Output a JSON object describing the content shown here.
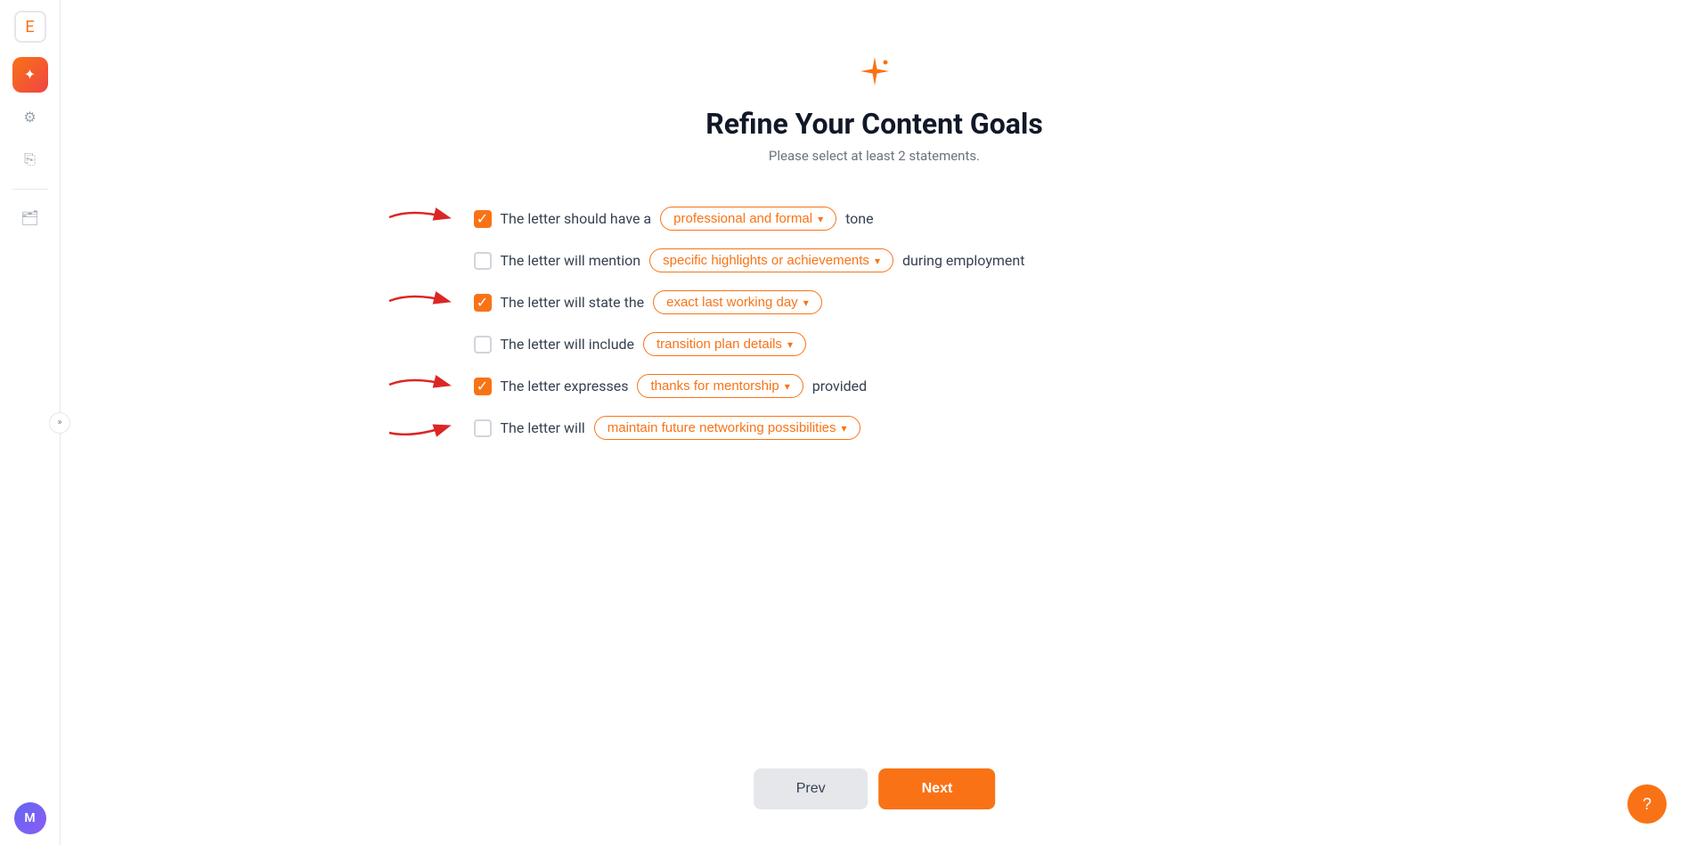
{
  "sidebar": {
    "logo_icon": "E",
    "items": [
      {
        "id": "sparkle",
        "icon": "✦",
        "active": true
      },
      {
        "id": "webhook",
        "icon": "⚙"
      },
      {
        "id": "copy",
        "icon": "⎘"
      }
    ],
    "collapse_icon": "»",
    "folder_icon": "📁",
    "avatar_label": "M"
  },
  "page": {
    "star_icon": "✦",
    "title": "Refine Your Content Goals",
    "subtitle": "Please select at least 2 statements."
  },
  "statements": [
    {
      "id": "tone",
      "checked": true,
      "prefix": "The letter should have a",
      "dropdown_value": "professional and formal",
      "suffix": "tone",
      "has_arrow": true
    },
    {
      "id": "highlights",
      "checked": false,
      "prefix": "The letter will mention",
      "dropdown_value": "specific highlights or achievements",
      "suffix": "during employment",
      "has_arrow": false
    },
    {
      "id": "lastday",
      "checked": true,
      "prefix": "The letter will state the",
      "dropdown_value": "exact last working day",
      "suffix": "",
      "has_arrow": true
    },
    {
      "id": "transition",
      "checked": false,
      "prefix": "The letter will include",
      "dropdown_value": "transition plan details",
      "suffix": "",
      "has_arrow": false
    },
    {
      "id": "mentorship",
      "checked": true,
      "prefix": "The letter expresses",
      "dropdown_value": "thanks for mentorship",
      "suffix": "provided",
      "has_arrow": true
    },
    {
      "id": "networking",
      "checked": false,
      "prefix": "The letter will",
      "dropdown_value": "maintain future networking possibilities",
      "suffix": "",
      "has_arrow": false
    }
  ],
  "footer": {
    "prev_label": "Prev",
    "next_label": "Next"
  },
  "support": {
    "icon": "?"
  }
}
